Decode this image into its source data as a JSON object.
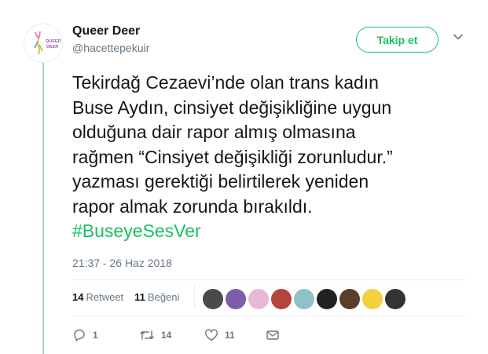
{
  "author": {
    "name": "Queer Deer",
    "handle": "@hacettepekuir",
    "avatar_text": "QUEER DEER"
  },
  "follow_button": {
    "label": "Takip et"
  },
  "tweet": {
    "lines": [
      "Tekirdağ Cezaevi’nde olan trans kadın",
      "Buse Aydın, cinsiyet değişikliğine uygun",
      "olduğuna dair rapor almış olmasına",
      "rağmen “Cinsiyet değişikliği zorunludur.”",
      "yazması gerektiği belirtilerek yeniden",
      "rapor almak zorunda bırakıldı."
    ],
    "hashtag": "#BuseyeSesVer",
    "timestamp": "21:37 - 26 Haz 2018"
  },
  "stats": {
    "retweets_count": "14",
    "retweets_label": "Retweet",
    "likes_count": "11",
    "likes_label": "Beğeni"
  },
  "likers": [
    {
      "name": "liker-1",
      "color": "#4a4a4a"
    },
    {
      "name": "liker-2",
      "color": "#7b5ea7"
    },
    {
      "name": "liker-3",
      "color": "#e8b9d6"
    },
    {
      "name": "liker-4",
      "color": "#b4453a"
    },
    {
      "name": "liker-5",
      "color": "#8fc1c7"
    },
    {
      "name": "liker-6",
      "color": "#222222"
    },
    {
      "name": "liker-7",
      "color": "#5a3e2b"
    },
    {
      "name": "liker-8",
      "color": "#f4d03f"
    },
    {
      "name": "liker-9",
      "color": "#333333"
    }
  ],
  "actions": {
    "reply_count": "1",
    "retweet_count": "14",
    "like_count": "11"
  },
  "colors": {
    "accent": "#17bf63",
    "thread_line": "#a6d9b6",
    "muted": "#657786"
  }
}
